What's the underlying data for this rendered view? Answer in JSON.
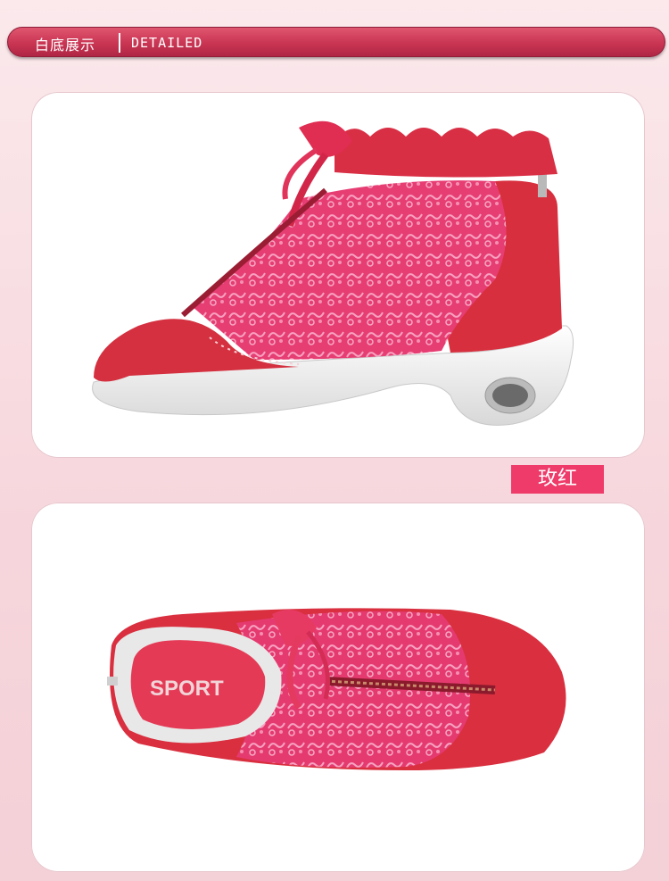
{
  "header": {
    "title_cn": "白底展示",
    "title_en": "DETAILED",
    "background_color": "#c93553"
  },
  "color_tag": {
    "label": "玫红",
    "background_color": "#ee3b6a"
  },
  "panels": [
    {
      "icon": "shoe-side-view-icon"
    },
    {
      "icon": "shoe-top-view-icon",
      "insole_text": "SPORT"
    }
  ]
}
